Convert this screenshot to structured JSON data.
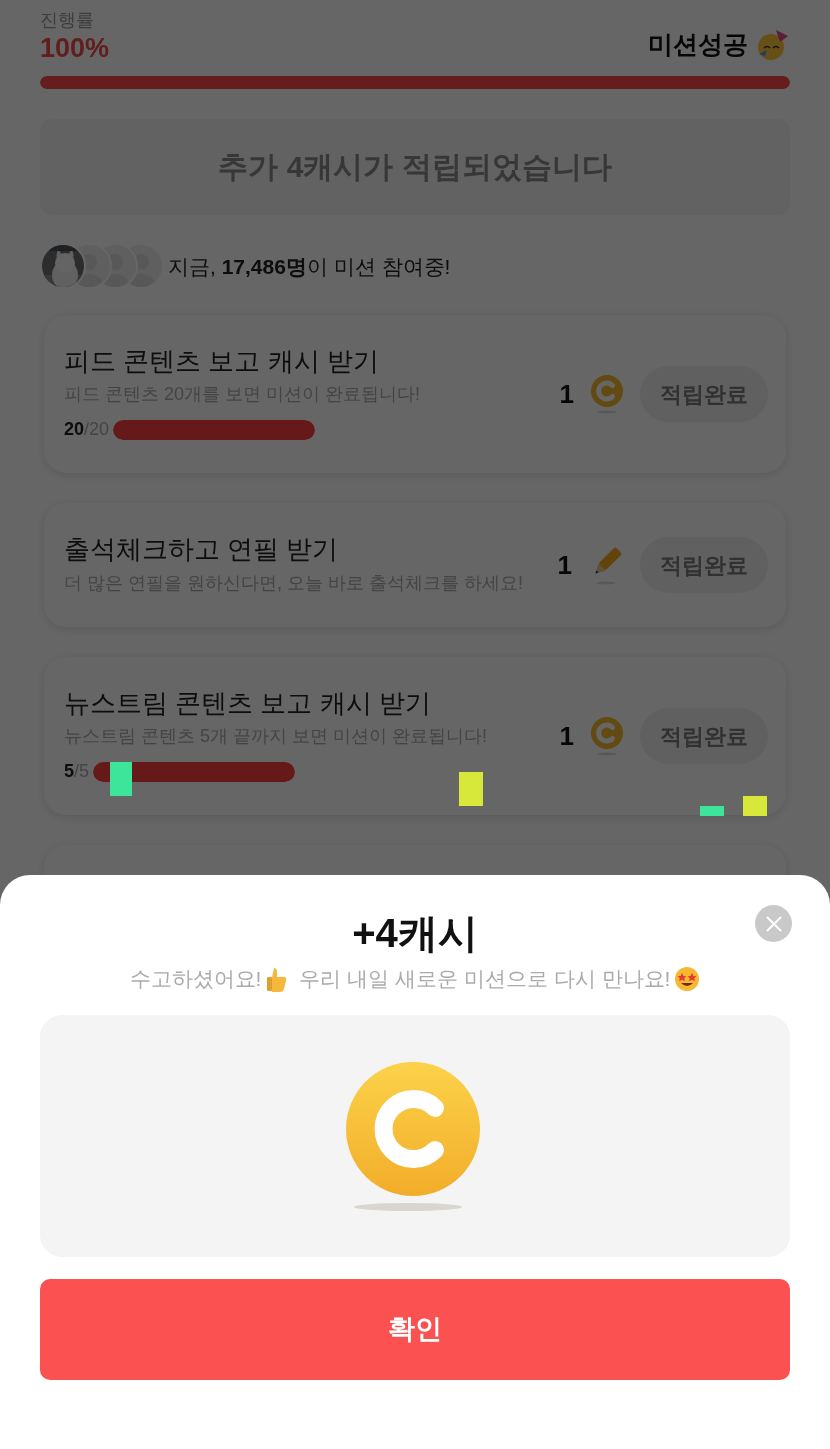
{
  "progress": {
    "label": "진행률",
    "value": "100%",
    "level": 1,
    "status": "미션성공"
  },
  "bonus_banner": "추가 4캐시가 적립되었습니다",
  "participants": {
    "text": "지금, **17,486명**이 미션 참여중!"
  },
  "missions": [
    {
      "title": "피드 콘텐츠 보고 캐시 받기",
      "description": "피드 콘텐츠 20개를 보면 미션이 완료됩니다!",
      "count": "20",
      "total": "/20",
      "level": 1,
      "reward": "1",
      "kind": "coin",
      "button": "적립완료"
    },
    {
      "title": "출석체크하고 연필 받기",
      "description": "더 많은 연필을 원하신다면, 오늘 바로 출석체크를 하세요!",
      "reward": "1",
      "kind": "pencil",
      "button": "적립완료"
    },
    {
      "title": "뉴스트림 콘텐츠 보고 캐시 받기",
      "description": "뉴스트림 콘텐츠 5개 끝까지 보면 미션이 완료됩니다!",
      "count": "5",
      "total": "/5",
      "level": 1,
      "reward": "1",
      "kind": "coin",
      "button": "적립완료"
    }
  ],
  "sheet": {
    "title": "+4캐시",
    "message_parts": [
      "수고하셨어요!",
      "우리 내일 새로운 미션으로 다시 만나요!"
    ],
    "button": "확인"
  }
}
